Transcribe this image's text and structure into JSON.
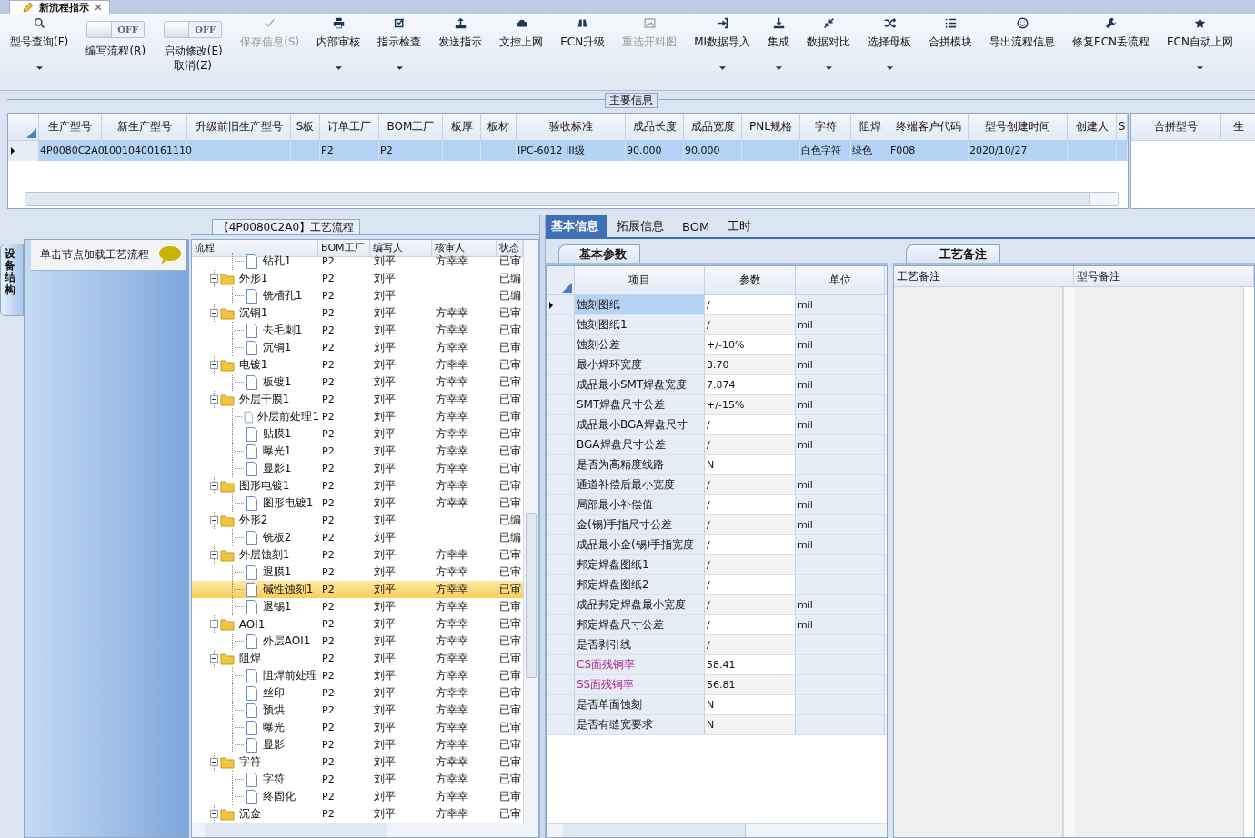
{
  "document_tab": {
    "title": "新流程指示"
  },
  "toolbar": [
    {
      "kind": "button",
      "label": "型号查询(F)",
      "disabled": false,
      "dropdown": true
    },
    {
      "kind": "toggle",
      "label": "编写流程(R)",
      "state_text": "OFF",
      "on": false
    },
    {
      "kind": "toggle",
      "label": "启动修改(E)取消(Z)",
      "state_text": "OFF",
      "on": false
    },
    {
      "kind": "button",
      "label": "保存信息(S)",
      "disabled": true,
      "dropdown": false
    },
    {
      "kind": "button",
      "label": "内部审核",
      "disabled": false,
      "dropdown": true
    },
    {
      "kind": "button",
      "label": "指示检查",
      "disabled": false,
      "dropdown": true
    },
    {
      "kind": "button",
      "label": "发送指示",
      "disabled": false,
      "dropdown": false
    },
    {
      "kind": "button",
      "label": "文控上网",
      "disabled": false,
      "dropdown": false
    },
    {
      "kind": "button",
      "label": "ECN升级",
      "disabled": false,
      "dropdown": false
    },
    {
      "kind": "button",
      "label": "重选开料图",
      "disabled": true,
      "dropdown": false
    },
    {
      "kind": "button",
      "label": "MI数据导入",
      "disabled": false,
      "dropdown": true
    },
    {
      "kind": "button",
      "label": "集成",
      "disabled": false,
      "dropdown": true
    },
    {
      "kind": "button",
      "label": "数据对比",
      "disabled": false,
      "dropdown": true
    },
    {
      "kind": "button",
      "label": "选择母板",
      "disabled": false,
      "dropdown": true
    },
    {
      "kind": "button",
      "label": "合拼模块",
      "disabled": false,
      "dropdown": false
    },
    {
      "kind": "button",
      "label": "导出流程信息",
      "disabled": false,
      "dropdown": false
    },
    {
      "kind": "button",
      "label": "修复ECN丢流程",
      "disabled": false,
      "dropdown": false
    },
    {
      "kind": "button",
      "label": "ECN自动上网",
      "disabled": false,
      "dropdown": true
    }
  ],
  "main_info": {
    "legend": "主要信息",
    "columns": [
      "生产型号",
      "新生产型号",
      "升级前旧生产型号",
      "S板",
      "订单工厂",
      "BOM工厂",
      "板厚",
      "板材",
      "验收标准",
      "成品长度",
      "成品宽度",
      "PNL规格",
      "字符",
      "阻焊",
      "终端客户代码",
      "型号创建时间",
      "创建人",
      "S"
    ],
    "rows": [
      {
        "selected": true,
        "cells": [
          "4P0080C2A0",
          "10010400161110",
          null,
          null,
          "P2",
          "P2",
          null,
          null,
          "IPC-6012 III级",
          "90.000",
          "90.000",
          null,
          "白色字符",
          "绿色",
          "F008",
          "2020/10/27",
          null,
          null
        ]
      }
    ]
  },
  "merge_table": {
    "columns": [
      "合拼型号",
      "生"
    ]
  },
  "side_panel": {
    "vertical_tab": "设备结构",
    "hint": "单击节点加载工艺流程"
  },
  "tree": {
    "title": "【4P0080C2A0】工艺流程",
    "columns": [
      "流程",
      "BOM工厂",
      "编写人",
      "核审人",
      "状态"
    ],
    "nodes": [
      {
        "kind": "file",
        "name": "钻孔1",
        "bom": "P2",
        "writer": "刘平",
        "reviewer": "方幸幸",
        "status": "已审",
        "selected": false
      },
      {
        "kind": "folder",
        "name": "外形1",
        "bom": "P2",
        "writer": "刘平",
        "status": "已编",
        "selected": false,
        "expanded": true,
        "children": [
          {
            "kind": "file",
            "name": "铣槽孔1",
            "bom": "P2",
            "writer": "刘平",
            "status": "已编",
            "selected": false
          }
        ]
      },
      {
        "kind": "folder",
        "name": "沉铜1",
        "bom": "P2",
        "writer": "刘平",
        "reviewer": "方幸幸",
        "status": "已审",
        "selected": false,
        "expanded": true,
        "children": [
          {
            "kind": "file",
            "name": "去毛刺1",
            "bom": "P2",
            "writer": "刘平",
            "reviewer": "方幸幸",
            "status": "已审",
            "selected": false
          },
          {
            "kind": "file",
            "name": "沉铜1",
            "bom": "P2",
            "writer": "刘平",
            "reviewer": "方幸幸",
            "status": "已审",
            "selected": false
          }
        ]
      },
      {
        "kind": "folder",
        "name": "电镀1",
        "bom": "P2",
        "writer": "刘平",
        "reviewer": "方幸幸",
        "status": "已审",
        "selected": false,
        "expanded": true,
        "children": [
          {
            "kind": "file",
            "name": "板镀1",
            "bom": "P2",
            "writer": "刘平",
            "reviewer": "方幸幸",
            "status": "已审",
            "selected": false
          }
        ]
      },
      {
        "kind": "folder",
        "name": "外层干膜1",
        "bom": "P2",
        "writer": "刘平",
        "reviewer": "方幸幸",
        "status": "已审",
        "selected": false,
        "expanded": true,
        "children": [
          {
            "kind": "file",
            "name": "外层前处理1",
            "bom": "P2",
            "writer": "刘平",
            "reviewer": "方幸幸",
            "status": "已审",
            "selected": false
          },
          {
            "kind": "file",
            "name": "贴膜1",
            "bom": "P2",
            "writer": "刘平",
            "reviewer": "方幸幸",
            "status": "已审",
            "selected": false
          },
          {
            "kind": "file",
            "name": "曝光1",
            "bom": "P2",
            "writer": "刘平",
            "reviewer": "方幸幸",
            "status": "已审",
            "selected": false
          },
          {
            "kind": "file",
            "name": "显影1",
            "bom": "P2",
            "writer": "刘平",
            "reviewer": "方幸幸",
            "status": "已审",
            "selected": false
          }
        ]
      },
      {
        "kind": "folder",
        "name": "图形电镀1",
        "bom": "P2",
        "writer": "刘平",
        "reviewer": "方幸幸",
        "status": "已审",
        "selected": false,
        "expanded": true,
        "children": [
          {
            "kind": "file",
            "name": "图形电镀1",
            "bom": "P2",
            "writer": "刘平",
            "reviewer": "方幸幸",
            "status": "已审",
            "selected": false
          }
        ]
      },
      {
        "kind": "folder",
        "name": "外形2",
        "bom": "P2",
        "writer": "刘平",
        "status": "已编",
        "selected": false,
        "expanded": true,
        "children": [
          {
            "kind": "file",
            "name": "铣板2",
            "bom": "P2",
            "writer": "刘平",
            "status": "已编",
            "selected": false
          }
        ]
      },
      {
        "kind": "folder",
        "name": "外层蚀刻1",
        "bom": "P2",
        "writer": "刘平",
        "reviewer": "方幸幸",
        "status": "已审",
        "selected": false,
        "expanded": true,
        "children": [
          {
            "kind": "file",
            "name": "退膜1",
            "bom": "P2",
            "writer": "刘平",
            "reviewer": "方幸幸",
            "status": "已审",
            "selected": false
          },
          {
            "kind": "file",
            "name": "碱性蚀刻1",
            "bom": "P2",
            "writer": "刘平",
            "reviewer": "方幸幸",
            "status": "已审",
            "selected": true
          },
          {
            "kind": "file",
            "name": "退锡1",
            "bom": "P2",
            "writer": "刘平",
            "reviewer": "方幸幸",
            "status": "已审",
            "selected": false
          }
        ]
      },
      {
        "kind": "folder",
        "name": "AOI1",
        "bom": "P2",
        "writer": "刘平",
        "reviewer": "方幸幸",
        "status": "已审",
        "selected": false,
        "expanded": true,
        "children": [
          {
            "kind": "file",
            "name": "外层AOI1",
            "bom": "P2",
            "writer": "刘平",
            "reviewer": "方幸幸",
            "status": "已审",
            "selected": false
          }
        ]
      },
      {
        "kind": "folder",
        "name": "阻焊",
        "bom": "P2",
        "writer": "刘平",
        "reviewer": "方幸幸",
        "status": "已审",
        "selected": false,
        "expanded": true,
        "children": [
          {
            "kind": "file",
            "name": "阻焊前处理",
            "bom": "P2",
            "writer": "刘平",
            "reviewer": "方幸幸",
            "status": "已审",
            "selected": false
          },
          {
            "kind": "file",
            "name": "丝印",
            "bom": "P2",
            "writer": "刘平",
            "reviewer": "方幸幸",
            "status": "已审",
            "selected": false
          },
          {
            "kind": "file",
            "name": "预烘",
            "bom": "P2",
            "writer": "刘平",
            "reviewer": "方幸幸",
            "status": "已审",
            "selected": false
          },
          {
            "kind": "file",
            "name": "曝光",
            "bom": "P2",
            "writer": "刘平",
            "reviewer": "方幸幸",
            "status": "已审",
            "selected": false
          },
          {
            "kind": "file",
            "name": "显影",
            "bom": "P2",
            "writer": "刘平",
            "reviewer": "方幸幸",
            "status": "已审",
            "selected": false
          }
        ]
      },
      {
        "kind": "folder",
        "name": "字符",
        "bom": "P2",
        "writer": "刘平",
        "reviewer": "方幸幸",
        "status": "已审",
        "selected": false,
        "expanded": true,
        "children": [
          {
            "kind": "file",
            "name": "字符",
            "bom": "P2",
            "writer": "刘平",
            "reviewer": "方幸幸",
            "status": "已审",
            "selected": false
          },
          {
            "kind": "file",
            "name": "终固化",
            "bom": "P2",
            "writer": "刘平",
            "reviewer": "方幸幸",
            "status": "已审",
            "selected": false
          }
        ]
      },
      {
        "kind": "folder",
        "name": "沉金",
        "bom": "P2",
        "writer": "刘平",
        "reviewer": "方幸幸",
        "status": "已审",
        "selected": false,
        "expanded": true
      }
    ]
  },
  "detail_tabs": [
    {
      "label": "基本信息",
      "selected": true
    },
    {
      "label": "拓展信息",
      "selected": false
    },
    {
      "label": "BOM",
      "selected": false
    },
    {
      "label": "工时",
      "selected": false
    }
  ],
  "params": {
    "tab": "基本参数",
    "columns": [
      "项目",
      "参数",
      "单位"
    ],
    "rows": [
      {
        "item": "蚀刻图纸",
        "value": "/",
        "unit": "mil",
        "selected": true,
        "highlighted": false
      },
      {
        "item": "蚀刻图纸1",
        "value": "/",
        "unit": "mil",
        "selected": false,
        "highlighted": false
      },
      {
        "item": "蚀刻公差",
        "value": "+/-10%",
        "unit": "mil",
        "selected": false,
        "highlighted": false
      },
      {
        "item": "最小焊环宽度",
        "value": "3.70",
        "unit": "mil",
        "selected": false,
        "highlighted": false
      },
      {
        "item": "成品最小SMT焊盘宽度",
        "value": "7.874",
        "unit": "mil",
        "selected": false,
        "highlighted": false
      },
      {
        "item": "SMT焊盘尺寸公差",
        "value": "+/-15%",
        "unit": "mil",
        "selected": false,
        "highlighted": false
      },
      {
        "item": "成品最小BGA焊盘尺寸",
        "value": "/",
        "unit": "mil",
        "selected": false,
        "highlighted": false
      },
      {
        "item": "BGA焊盘尺寸公差",
        "value": "/",
        "unit": "mil",
        "selected": false,
        "highlighted": false
      },
      {
        "item": "是否为高精度线路",
        "value": "N",
        "selected": false,
        "highlighted": false
      },
      {
        "item": "通道补偿后最小宽度",
        "value": "/",
        "unit": "mil",
        "selected": false,
        "highlighted": false
      },
      {
        "item": "局部最小补偿值",
        "value": "/",
        "unit": "mil",
        "selected": false,
        "highlighted": false
      },
      {
        "item": "金(锡)手指尺寸公差",
        "value": "/",
        "unit": "mil",
        "selected": false,
        "highlighted": false
      },
      {
        "item": "成品最小金(锡)手指宽度",
        "value": "/",
        "unit": "mil",
        "selected": false,
        "highlighted": false
      },
      {
        "item": "邦定焊盘图纸1",
        "value": "/",
        "selected": false,
        "highlighted": false
      },
      {
        "item": "邦定焊盘图纸2",
        "value": "/",
        "selected": false,
        "highlighted": false
      },
      {
        "item": "成品邦定焊盘最小宽度",
        "value": "/",
        "unit": "mil",
        "selected": false,
        "highlighted": false
      },
      {
        "item": "邦定焊盘尺寸公差",
        "value": "/",
        "unit": "mil",
        "selected": false,
        "highlighted": false
      },
      {
        "item": "是否剥引线",
        "value": "/",
        "selected": false,
        "highlighted": false
      },
      {
        "item": "CS面残铜率",
        "value": "58.41",
        "selected": false,
        "highlighted": true
      },
      {
        "item": "SS面残铜率",
        "value": "56.81",
        "selected": false,
        "highlighted": true
      },
      {
        "item": "是否单面蚀刻",
        "value": "N",
        "selected": false,
        "highlighted": false
      },
      {
        "item": "是否有缝宽要求",
        "value": "N",
        "selected": false,
        "highlighted": false
      }
    ]
  },
  "notes": {
    "tab": "工艺备注",
    "columns": [
      "工艺备注",
      "型号备注"
    ]
  }
}
